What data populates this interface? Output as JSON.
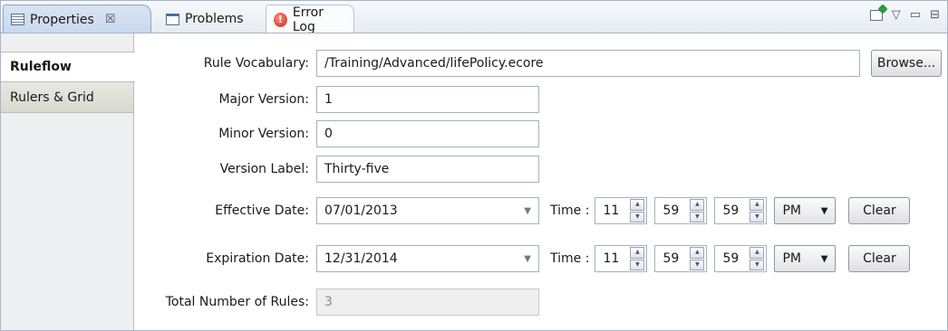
{
  "tabs": {
    "properties": "Properties",
    "properties_close": "☒",
    "problems": "Problems",
    "error_log": "Error Log"
  },
  "view_tools": {
    "menu": "▽",
    "minimize": "▭",
    "maximize": "⊟"
  },
  "sidebar": {
    "items": [
      {
        "label": "Ruleflow",
        "active": true
      },
      {
        "label": "Rulers & Grid",
        "active": false
      }
    ]
  },
  "form": {
    "rule_vocabulary": {
      "label": "Rule Vocabulary:",
      "value": "/Training/Advanced/lifePolicy.ecore",
      "browse": "Browse..."
    },
    "major_version": {
      "label": "Major Version:",
      "value": "1"
    },
    "minor_version": {
      "label": "Minor Version:",
      "value": "0"
    },
    "version_label": {
      "label": "Version Label:",
      "value": "Thirty-five"
    },
    "effective_date": {
      "label": "Effective Date:",
      "value": "07/01/2013",
      "time_label": "Time :",
      "hour": "11",
      "minute": "59",
      "second": "59",
      "ampm": "PM",
      "clear": "Clear"
    },
    "expiration_date": {
      "label": "Expiration Date:",
      "value": "12/31/2014",
      "time_label": "Time :",
      "hour": "11",
      "minute": "59",
      "second": "59",
      "ampm": "PM",
      "clear": "Clear"
    },
    "total_rules": {
      "label": "Total Number of Rules:",
      "value": "3"
    }
  }
}
